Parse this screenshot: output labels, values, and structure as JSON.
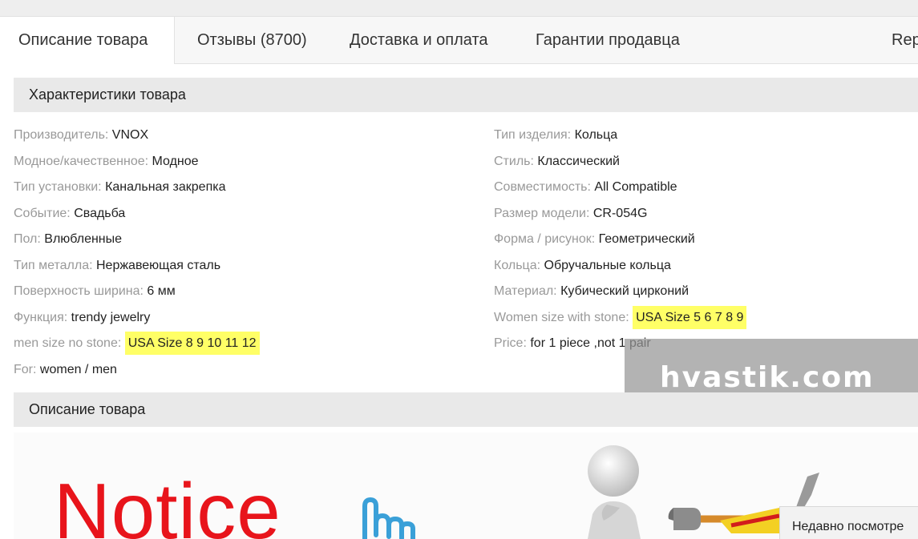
{
  "tabs": [
    {
      "label": "Описание товара"
    },
    {
      "label": "Отзывы (8700)"
    },
    {
      "label": "Доставка и оплата"
    },
    {
      "label": "Гарантии продавца"
    },
    {
      "label": "Rep"
    }
  ],
  "characteristics": {
    "header": "Характеристики товара",
    "left": [
      {
        "key": "Производитель:",
        "value": "VNOX"
      },
      {
        "key": "Модное/качественное:",
        "value": "Модное"
      },
      {
        "key": "Тип установки:",
        "value": "Канальная закрепка"
      },
      {
        "key": "Событие:",
        "value": "Свадьба"
      },
      {
        "key": "Пол:",
        "value": "Влюбленные"
      },
      {
        "key": "Тип металла:",
        "value": "Нержавеющая сталь"
      },
      {
        "key": "Поверхность ширина:",
        "value": "6 мм"
      },
      {
        "key": "Функция:",
        "value": "trendy jewelry"
      },
      {
        "key": "men size no stone:",
        "value": "USA Size 8 9 10 11 12",
        "highlight": true
      },
      {
        "key": "For:",
        "value": "women / men"
      }
    ],
    "right": [
      {
        "key": "Тип изделия:",
        "value": "Кольца"
      },
      {
        "key": "Стиль:",
        "value": "Классический"
      },
      {
        "key": "Совместимость:",
        "value": "All Compatible"
      },
      {
        "key": "Размер модели:",
        "value": "CR-054G"
      },
      {
        "key": "Форма / рисунок:",
        "value": "Геометрический"
      },
      {
        "key": "Кольца:",
        "value": "Обручальные кольца"
      },
      {
        "key": "Материал:",
        "value": "Кубический цирконий"
      },
      {
        "key": "Women size with stone:",
        "value": "USA Size 5 6 7 8 9",
        "highlight": true
      },
      {
        "key": "Price:",
        "value": "for 1 piece ,not 1 pair"
      }
    ]
  },
  "description": {
    "header": "Описание товара",
    "image_text": "Notice"
  },
  "watermark": "hvastik.com",
  "recently_viewed": "Недавно посмотре",
  "colors": {
    "highlight": "#ffff66",
    "notice_red": "#e8141b",
    "label_gray": "#999999"
  }
}
